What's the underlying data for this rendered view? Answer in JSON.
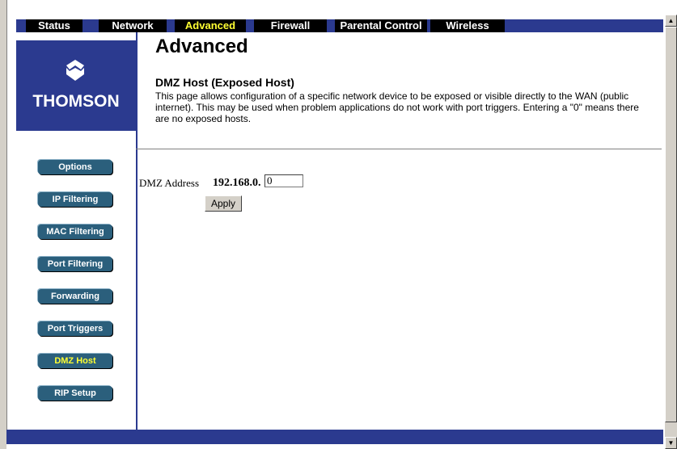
{
  "nav": {
    "tabs": [
      {
        "label": "Status"
      },
      {
        "label": "Network"
      },
      {
        "label": "Advanced"
      },
      {
        "label": "Firewall"
      },
      {
        "label": "Parental Control"
      },
      {
        "label": "Wireless"
      }
    ],
    "active_tab": "Advanced"
  },
  "brand": {
    "name": "THOMSON"
  },
  "sidebar": {
    "items": [
      {
        "label": "Options"
      },
      {
        "label": "IP Filtering"
      },
      {
        "label": "MAC Filtering"
      },
      {
        "label": "Port Filtering"
      },
      {
        "label": "Forwarding"
      },
      {
        "label": "Port Triggers"
      },
      {
        "label": "DMZ Host"
      },
      {
        "label": "RIP Setup"
      }
    ],
    "active_item": "DMZ Host"
  },
  "main": {
    "title": "Advanced",
    "section_title": "DMZ Host (Exposed Host)",
    "description": "This page allows configuration of a specific network device to be exposed or visible directly to the WAN (public internet).  This may be used when problem applications do not work with port triggers. Entering a \"0\" means there are no exposed hosts."
  },
  "form": {
    "dmz_label": "DMZ Address",
    "dmz_prefix": "192.168.0.",
    "dmz_value": "0",
    "apply_label": "Apply"
  },
  "colors": {
    "navy": "#2b3a8f",
    "button_teal": "#2b5f7c",
    "active_yellow": "#ffff33"
  },
  "icons": {
    "scroll_up": "▲",
    "scroll_down": "▼"
  }
}
